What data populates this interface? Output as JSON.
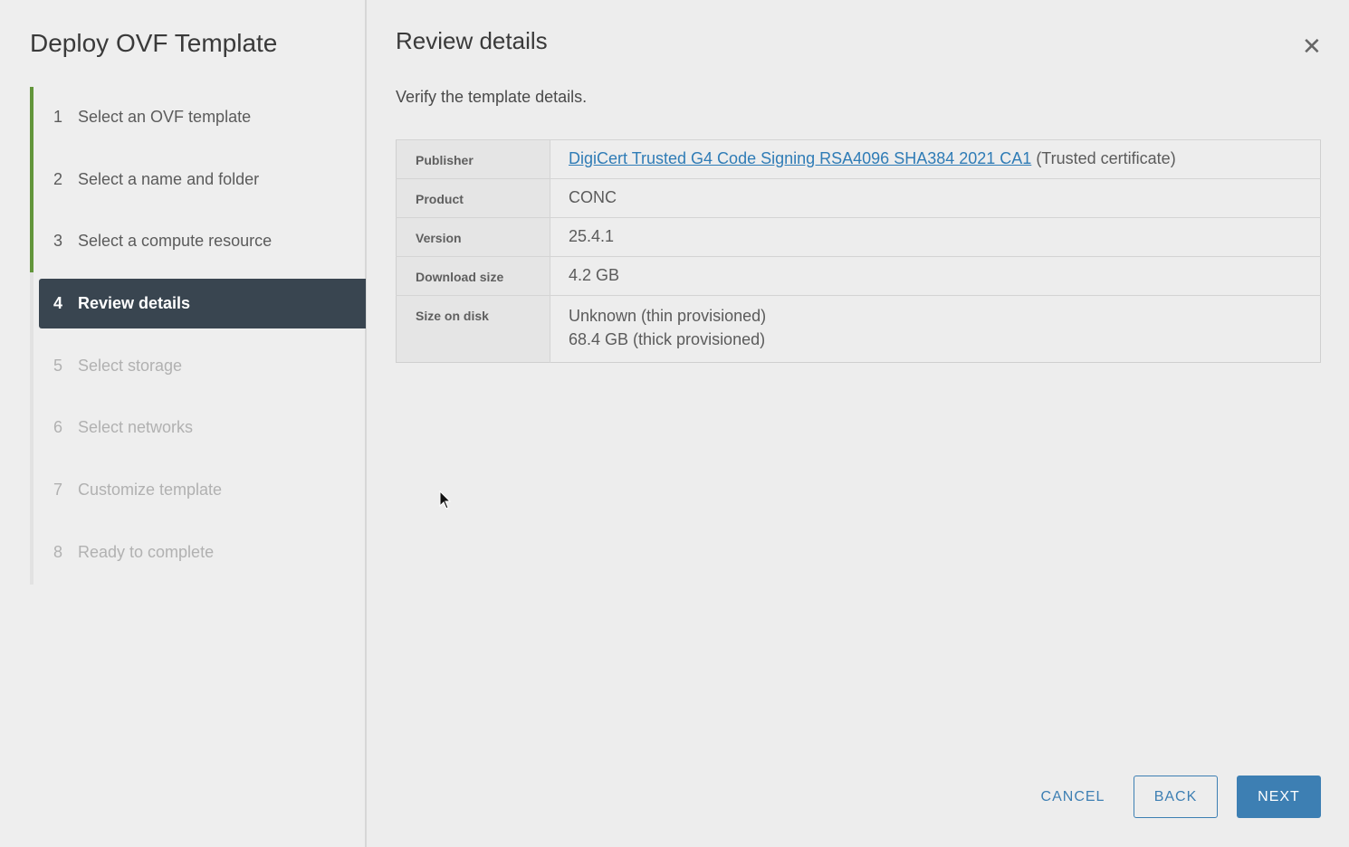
{
  "title": "Deploy OVF Template",
  "steps": [
    {
      "num": "1",
      "label": "Select an OVF template",
      "state": "done"
    },
    {
      "num": "2",
      "label": "Select a name and folder",
      "state": "done"
    },
    {
      "num": "3",
      "label": "Select a compute resource",
      "state": "done"
    },
    {
      "num": "4",
      "label": "Review details",
      "state": "active"
    },
    {
      "num": "5",
      "label": "Select storage",
      "state": "todo"
    },
    {
      "num": "6",
      "label": "Select networks",
      "state": "todo"
    },
    {
      "num": "7",
      "label": "Customize template",
      "state": "todo"
    },
    {
      "num": "8",
      "label": "Ready to complete",
      "state": "todo"
    }
  ],
  "main": {
    "heading": "Review details",
    "subtitle": "Verify the template details.",
    "details": {
      "publisher_label": "Publisher",
      "publisher_link": "DigiCert Trusted G4 Code Signing RSA4096 SHA384 2021 CA1",
      "publisher_note": "(Trusted certificate)",
      "product_label": "Product",
      "product": "CONC",
      "version_label": "Version",
      "version": "25.4.1",
      "download_label": "Download size",
      "download": "4.2 GB",
      "disk_label": "Size on disk",
      "disk_thin": "Unknown (thin provisioned)",
      "disk_thick": "68.4 GB (thick provisioned)"
    }
  },
  "buttons": {
    "cancel": "CANCEL",
    "back": "BACK",
    "next": "NEXT"
  },
  "colors": {
    "accent": "#3d7fb3",
    "progress": "#62953a",
    "active_step": "#394550"
  }
}
